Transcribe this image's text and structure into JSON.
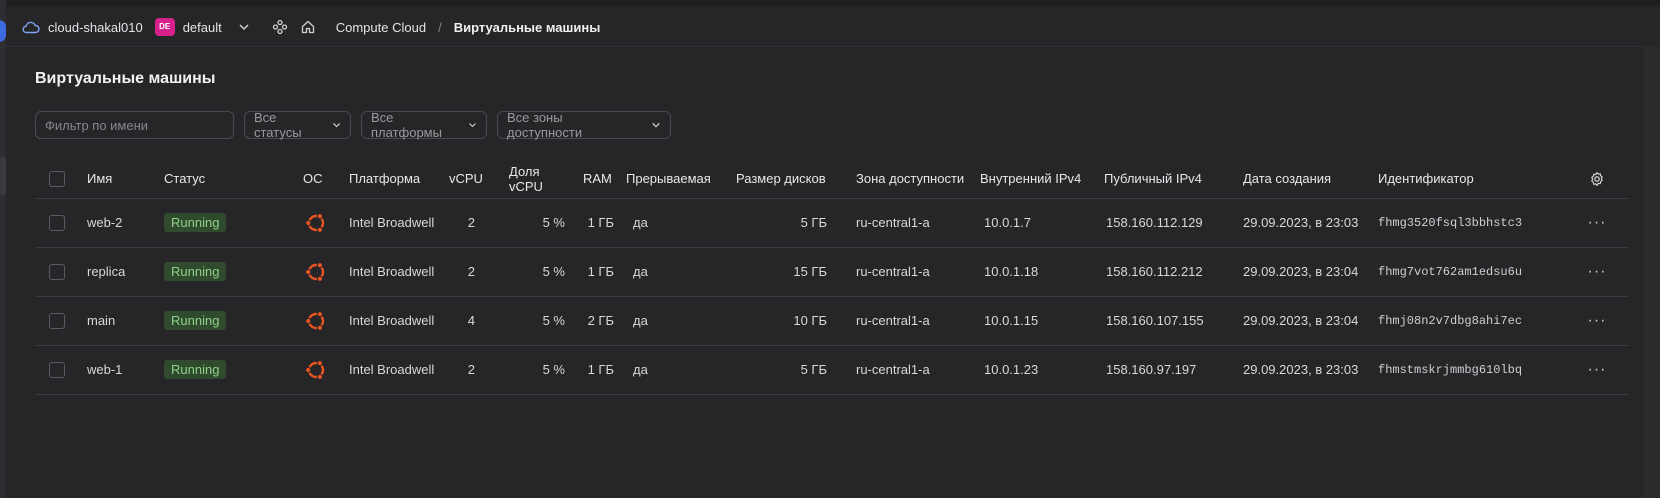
{
  "header": {
    "cloud_name": "cloud-shakal010",
    "folder_badge": "DE",
    "folder_name": "default",
    "breadcrumb": [
      "Compute Cloud",
      "Виртуальные машины"
    ],
    "separator": "/"
  },
  "page": {
    "title": "Виртуальные машины"
  },
  "filters": {
    "name_placeholder": "Фильтр по имени",
    "status": "Все статусы",
    "platform": "Все платформы",
    "zone": "Все зоны доступности"
  },
  "table": {
    "columns": [
      "Имя",
      "Статус",
      "ОС",
      "Платформа",
      "vCPU",
      "Доля vCPU",
      "RAM",
      "Прерываемая",
      "Размер дисков",
      "Зона доступности",
      "Внутренний IPv4",
      "Публичный IPv4",
      "Дата создания",
      "Идентификатор"
    ],
    "rows": [
      {
        "name": "web-2",
        "status": "Running",
        "os": "ubuntu-icon",
        "platform": "Intel Broadwell",
        "vcpu": "2",
        "share": "5 %",
        "ram": "1 ГБ",
        "preemptible": "да",
        "disk": "5 ГБ",
        "zone": "ru-central1-a",
        "internal_ip": "10.0.1.7",
        "public_ip": "158.160.112.129",
        "created": "29.09.2023, в 23:03",
        "id": "fhmg3520fsql3bbhstc3"
      },
      {
        "name": "replica",
        "status": "Running",
        "os": "ubuntu-icon",
        "platform": "Intel Broadwell",
        "vcpu": "2",
        "share": "5 %",
        "ram": "1 ГБ",
        "preemptible": "да",
        "disk": "15 ГБ",
        "zone": "ru-central1-a",
        "internal_ip": "10.0.1.18",
        "public_ip": "158.160.112.212",
        "created": "29.09.2023, в 23:04",
        "id": "fhmg7vot762am1edsu6u"
      },
      {
        "name": "main",
        "status": "Running",
        "os": "ubuntu-icon",
        "platform": "Intel Broadwell",
        "vcpu": "4",
        "share": "5 %",
        "ram": "2 ГБ",
        "preemptible": "да",
        "disk": "10 ГБ",
        "zone": "ru-central1-a",
        "internal_ip": "10.0.1.15",
        "public_ip": "158.160.107.155",
        "created": "29.09.2023, в 23:04",
        "id": "fhmj08n2v7dbg8ahi7ec"
      },
      {
        "name": "web-1",
        "status": "Running",
        "os": "ubuntu-icon",
        "platform": "Intel Broadwell",
        "vcpu": "2",
        "share": "5 %",
        "ram": "1 ГБ",
        "preemptible": "да",
        "disk": "5 ГБ",
        "zone": "ru-central1-a",
        "internal_ip": "10.0.1.23",
        "public_ip": "158.160.97.197",
        "created": "29.09.2023, в 23:03",
        "id": "fhmstmskrjmmbg610lbq"
      }
    ]
  },
  "colors": {
    "background": "#262629",
    "status_running_bg": "#2f4a2c",
    "status_running_text": "#8fd18a",
    "ubuntu_orange": "#e95420",
    "folder_badge": "#d6208c"
  }
}
